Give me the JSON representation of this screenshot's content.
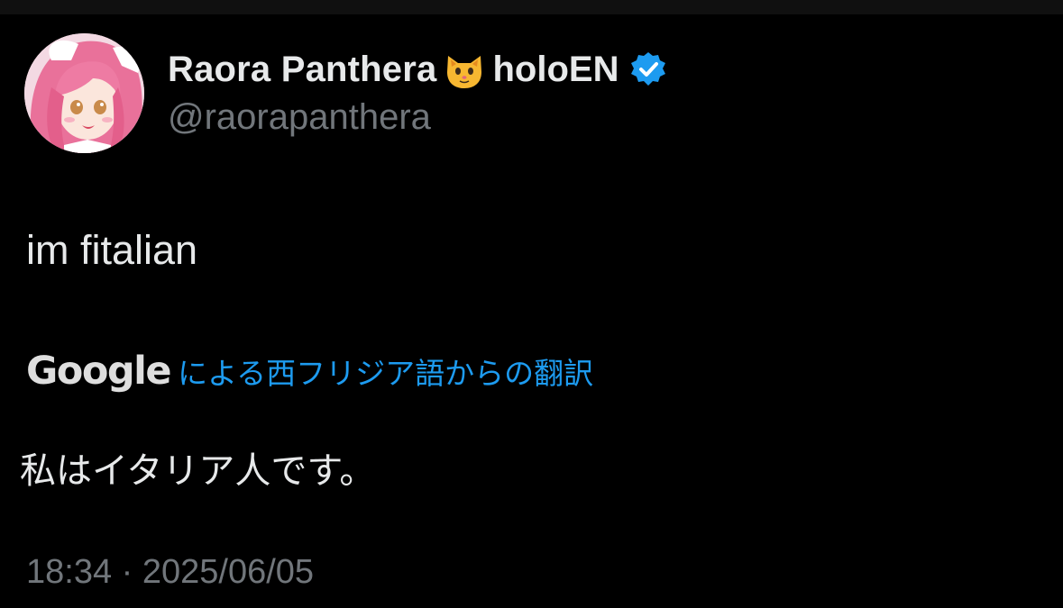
{
  "author": {
    "display_name": "Raora Panthera",
    "emoji_icon": "cat-face-icon",
    "tag": "holoEN",
    "verified_icon": "verified-badge-icon",
    "verified_color": "#1d9bf0",
    "handle": "@raorapanthera",
    "avatar_icon": "profile-avatar"
  },
  "tweet": {
    "text": "im fitalian"
  },
  "translation": {
    "provider": "Google",
    "label": "による西フリジア語からの翻訳",
    "text": "私はイタリア人です。"
  },
  "meta": {
    "timestamp": "18:34 · 2025/06/05"
  },
  "colors": {
    "background": "#000000",
    "primary_text": "#e7e9ea",
    "secondary_text": "#71767b",
    "link": "#1d9bf0"
  }
}
